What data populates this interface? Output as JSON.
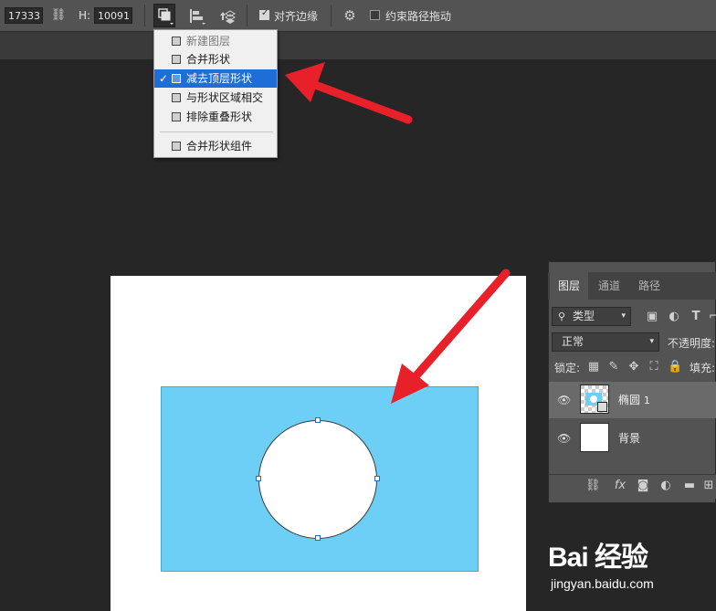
{
  "options_bar": {
    "width_value": "17333 |",
    "height_label": "H:",
    "height_value": "10091 |",
    "align_edges_label": "对齐边缘",
    "align_edges_checked": true,
    "constrain_path_label": "约束路径拖动",
    "constrain_path_checked": false
  },
  "path_ops_menu": {
    "items": [
      {
        "label": "新建图层",
        "disabled": true,
        "selected": false
      },
      {
        "label": "合并形状",
        "disabled": false,
        "selected": false
      },
      {
        "label": "减去顶层形状",
        "disabled": false,
        "selected": true
      },
      {
        "label": "与形状区域相交",
        "disabled": false,
        "selected": false
      },
      {
        "label": "排除重叠形状",
        "disabled": false,
        "selected": false
      },
      {
        "label": "合并形状组件",
        "disabled": false,
        "selected": false
      }
    ]
  },
  "canvas": {
    "rect_color": "#6dcff6",
    "hole_color": "#ffffff"
  },
  "layers_panel": {
    "tabs": [
      "图层",
      "通道",
      "路径"
    ],
    "active_tab": "图层",
    "filter_label": "类型",
    "blend_mode": "正常",
    "opacity_label": "不透明度:",
    "lock_label": "锁定:",
    "fill_label": "填充:",
    "layers": [
      {
        "name": "椭圆",
        "number": "1",
        "selected": true
      },
      {
        "name": "背景",
        "number": "",
        "selected": false
      }
    ]
  },
  "watermark": {
    "logo_text": "Bai 经验",
    "url": "jingyan.baidu.com"
  },
  "colors": {
    "selection_blue": "#1e6ed8",
    "annotation_red": "#e8202a"
  }
}
